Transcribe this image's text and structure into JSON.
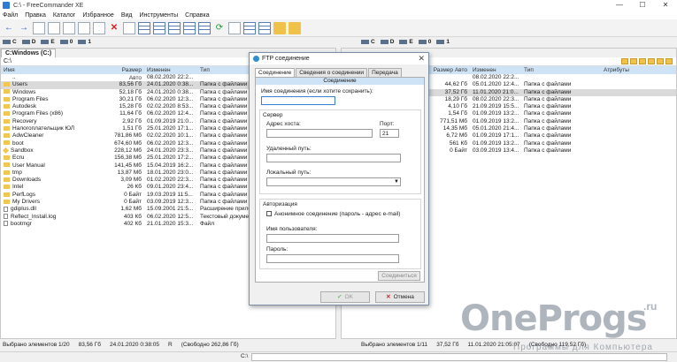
{
  "window": {
    "title": "C:\\ - FreeCommander XE"
  },
  "menu": [
    "Файл",
    "Правка",
    "Каталог",
    "Избранное",
    "Вид",
    "Инструменты",
    "Справка"
  ],
  "drives_left": [
    {
      "label": "C"
    },
    {
      "label": "D"
    },
    {
      "label": "E"
    },
    {
      "label": "0"
    },
    {
      "label": "1"
    }
  ],
  "drives_right": [
    {
      "label": "C"
    },
    {
      "label": "D"
    },
    {
      "label": "E"
    },
    {
      "label": "0"
    },
    {
      "label": "1"
    }
  ],
  "left_panel": {
    "tab": "C:Windows (C:)",
    "path": "C:\\",
    "columns": [
      "Имя",
      "Размер Авто",
      "Изменен",
      "Тип"
    ],
    "rows": [
      {
        "name": "..",
        "size": "",
        "date": "08.02.2020 22:2...",
        "type": "",
        "icon": "up"
      },
      {
        "name": "Users",
        "size": "83,56 Гб",
        "date": "24.01.2020 0:38...",
        "type": "Папка с файлами",
        "icon": "folder",
        "sel": true
      },
      {
        "name": "Windows",
        "size": "52,18 Гб",
        "date": "24.01.2020 0:38...",
        "type": "Папка с файлами",
        "icon": "folder"
      },
      {
        "name": "Program Files",
        "size": "30,21 Гб",
        "date": "06.02.2020 12:3...",
        "type": "Папка с файлами",
        "icon": "folder"
      },
      {
        "name": "Autodesk",
        "size": "15,28 Гб",
        "date": "02.02.2020 8:53...",
        "type": "Папка с файлами",
        "icon": "folder"
      },
      {
        "name": "Program Files (x86)",
        "size": "11,64 Гб",
        "date": "06.02.2020 12:4...",
        "type": "Папка с файлами",
        "icon": "folder"
      },
      {
        "name": "Recovery",
        "size": "2,92 Гб",
        "date": "01.09.2019 21:0...",
        "type": "Папка с файлами",
        "icon": "folder"
      },
      {
        "name": "Налогоплательщик ЮЛ",
        "size": "1,51 Гб",
        "date": "25.01.2020 17:1...",
        "type": "Папка с файлами",
        "icon": "folder"
      },
      {
        "name": "AdwCleaner",
        "size": "781,86 Мб",
        "date": "02.02.2020 10:1...",
        "type": "Папка с файлами",
        "icon": "folder"
      },
      {
        "name": "boot",
        "size": "674,60 Мб",
        "date": "06.02.2020 12:3...",
        "type": "Папка с файлами",
        "icon": "folder"
      },
      {
        "name": "Sandbox",
        "size": "228,12 Мб",
        "date": "24.01.2020 23:3...",
        "type": "Папка с файлами",
        "icon": "sandbox"
      },
      {
        "name": "Ecru",
        "size": "156,38 Мб",
        "date": "25.01.2020 17:2...",
        "type": "Папка с файлами",
        "icon": "folder"
      },
      {
        "name": "User Manual",
        "size": "141,45 Мб",
        "date": "15.04.2019 16:2...",
        "type": "Папка с файлами",
        "icon": "folder"
      },
      {
        "name": "tmp",
        "size": "13,87 Мб",
        "date": "18.01.2020 23:0...",
        "type": "Папка с файлами",
        "icon": "folder"
      },
      {
        "name": "Downloads",
        "size": "3,09 Мб",
        "date": "01.02.2020 22:3...",
        "type": "Папка с файлами",
        "icon": "folder"
      },
      {
        "name": "Intel",
        "size": "26 Кб",
        "date": "09.01.2020 23:4...",
        "type": "Папка с файлами",
        "icon": "folder"
      },
      {
        "name": "PerfLogs",
        "size": "0 Байт",
        "date": "19.03.2019 11:5...",
        "type": "Папка с файлами",
        "icon": "folder"
      },
      {
        "name": "My Drivers",
        "size": "0 Байт",
        "date": "03.09.2019 12:3...",
        "type": "Папка с файлами",
        "icon": "folder"
      },
      {
        "name": "gdiplus.dll",
        "size": "1,62 Мб",
        "date": "15.09.2001 21:5...",
        "type": "Расширение прило",
        "icon": "file"
      },
      {
        "name": "Reflect_Install.log",
        "size": "403 Кб",
        "date": "06.02.2020 12:5...",
        "type": "Текстовый докуме",
        "icon": "file"
      },
      {
        "name": "bootmgr",
        "size": "402 Кб",
        "date": "21.01.2020 15:3...",
        "type": "Файл",
        "icon": "file"
      }
    ],
    "status": [
      "Выбрано элементов 1/20",
      "83,56 Гб",
      "24.01.2020 0:38:05",
      "R",
      "(Свободно 262,86 Гб)"
    ]
  },
  "right_panel": {
    "columns": [
      "Размер Авто",
      "Изменен",
      "Тип",
      "Атрибуты"
    ],
    "rows": [
      {
        "size": "",
        "date": "08.02.2020 22:2...",
        "type": ""
      },
      {
        "size": "44,62 Гб",
        "date": "05.01.2020 12:4...",
        "type": "Папка с файлами"
      },
      {
        "size": "37,52 Гб",
        "date": "11.01.2020 21:0...",
        "type": "Папка с файлами",
        "sel": true
      },
      {
        "size": "18,29 Гб",
        "date": "08.02.2020 22:3...",
        "type": "Папка с файлами"
      },
      {
        "size": "4,10 Гб",
        "date": "21.09.2019 15:5...",
        "type": "Папка с файлами"
      },
      {
        "size": "1,54 Гб",
        "date": "01.09.2019 13:2...",
        "type": "Папка с файлами"
      },
      {
        "size": "771,51 Мб",
        "date": "01.09.2019 13:2...",
        "type": "Папка с файлами"
      },
      {
        "size": "14,35 Мб",
        "date": "05.01.2020 21:4...",
        "type": "Папка с файлами"
      },
      {
        "size": "6,72 Мб",
        "date": "01.09.2019 17:1...",
        "type": "Папка с файлами"
      },
      {
        "size": "561 Кб",
        "date": "01.09.2019 13:2...",
        "type": "Папка с файлами"
      },
      {
        "size": "0 Байт",
        "date": "03.09.2019 13:4...",
        "type": "Папка с файлами"
      }
    ],
    "status": [
      "Выбрано элементов 1/11",
      "37,52 Гб",
      "11.01.2020 21:05:07",
      "(Свободно 119,52 Гб)"
    ]
  },
  "cmdline": {
    "label": "C:\\"
  },
  "dialog": {
    "title": "FTP соединение",
    "tabs": [
      "Соединение",
      "Сведения о соединении",
      "Передача"
    ],
    "band": "Соединение",
    "conn_name_label": "Имя соединения (если хотите сохранить):",
    "server_group": "Сервер",
    "host_label": "Адрес хоста:",
    "port_label": "Порт:",
    "port_value": "21",
    "remote_path_label": "Удаленный путь:",
    "local_path_label": "Локальный путь:",
    "auth_group": "Авторизация",
    "anon_label": "Анонимное соединение (пароль - адрес e-mail)",
    "user_label": "Имя пользователя:",
    "pass_label": "Пароль:",
    "connect_btn": "Соединиться",
    "ok_btn": "OK",
    "cancel_btn": "Отмена"
  },
  "watermark": {
    "brand": "OneProgs",
    "tld": ".ru",
    "tagline": "Программы для Компьютера"
  }
}
